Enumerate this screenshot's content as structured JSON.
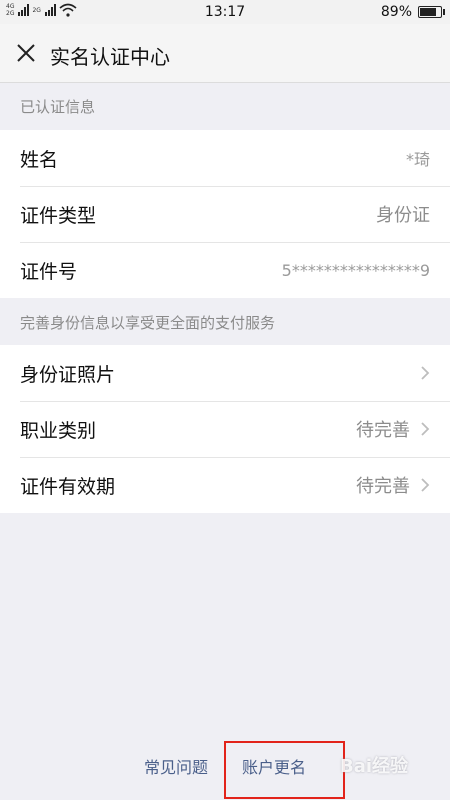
{
  "status_bar": {
    "network_1": "4G",
    "network_2": "2G",
    "network_3": "2G",
    "time": "13:17",
    "battery_percent": "89%",
    "battery_level": 0.89
  },
  "nav": {
    "title": "实名认证中心"
  },
  "verified_section": {
    "header": "已认证信息",
    "rows": [
      {
        "label": "姓名",
        "value": "*琦"
      },
      {
        "label": "证件类型",
        "value": "身份证"
      },
      {
        "label": "证件号",
        "value": "5****************9"
      }
    ]
  },
  "complete_section": {
    "header": "完善身份信息以享受更全面的支付服务",
    "rows": [
      {
        "label": "身份证照片",
        "value": ""
      },
      {
        "label": "职业类别",
        "value": "待完善"
      },
      {
        "label": "证件有效期",
        "value": "待完善"
      }
    ]
  },
  "footer": {
    "faq": "常见问题",
    "rename": "账户更名"
  },
  "watermark": "Bai经验",
  "colors": {
    "background": "#efeff4",
    "link": "#4a5f8a",
    "highlight": "#e2231a"
  }
}
